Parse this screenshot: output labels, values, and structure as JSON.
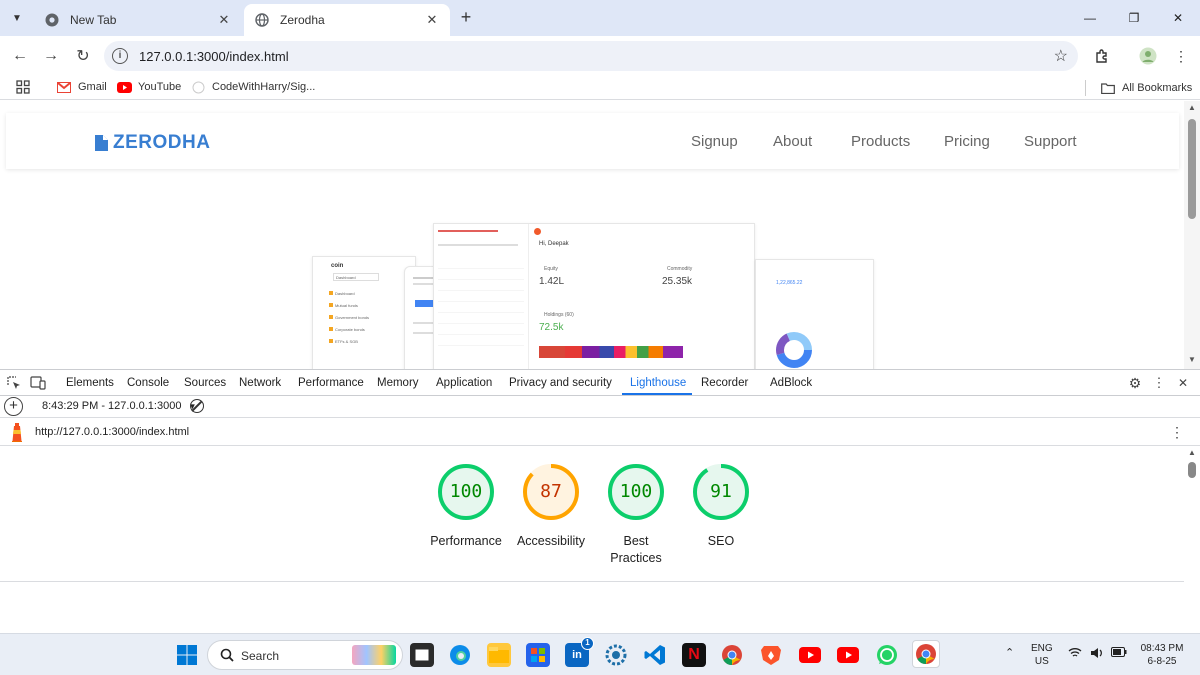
{
  "browser": {
    "tabs": [
      {
        "title": "New Tab",
        "active": false
      },
      {
        "title": "Zerodha",
        "active": true
      }
    ],
    "url": "127.0.0.1:3000/index.html",
    "bookmarks": [
      {
        "label": "Gmail"
      },
      {
        "label": "YouTube"
      },
      {
        "label": "CodeWithHarry/Sig..."
      }
    ],
    "all_bookmarks_label": "All Bookmarks"
  },
  "site": {
    "logo_text": "ZERODHA",
    "nav": [
      "Signup",
      "About",
      "Products",
      "Pricing",
      "Support"
    ],
    "hero_mock": {
      "greeting": "Hi, Deepak",
      "equity_label": "Equity",
      "equity_value": "1.42L",
      "commodity_label": "Commodity",
      "commodity_value": "25.35k",
      "holdings_label": "Holdings (60)",
      "holdings_value": "72.5k",
      "coin_label": "coin",
      "coin_menu": [
        "Dashboard",
        "Mutual funds",
        "Government bonds",
        "Corporate bonds",
        "ETFs & SGB"
      ],
      "coin_dropdown": "Dashboard",
      "portfolio_value": "1,22,865.22"
    }
  },
  "devtools": {
    "tabs": [
      "Elements",
      "Console",
      "Sources",
      "Network",
      "Performance",
      "Memory",
      "Application",
      "Privacy and security",
      "Lighthouse",
      "Recorder",
      "AdBlock"
    ],
    "active_tab": "Lighthouse",
    "report_select": "8:43:29 PM - 127.0.0.1:3000",
    "report_url": "http://127.0.0.1:3000/index.html",
    "scores": [
      {
        "label": "Performance",
        "score": 100,
        "status": "pass"
      },
      {
        "label": "Accessibility",
        "score": 87,
        "status": "average"
      },
      {
        "label": "Best Practices",
        "score": 100,
        "status": "pass"
      },
      {
        "label": "SEO",
        "score": 91,
        "status": "pass"
      }
    ],
    "colors": {
      "pass_stroke": "#0cce6b",
      "pass_fill": "#e6f7ee",
      "pass_text": "#008800",
      "average_stroke": "#ffa400",
      "average_fill": "#fff3e0",
      "average_text": "#c33300"
    }
  },
  "taskbar": {
    "search_placeholder": "Search",
    "language": "ENG",
    "region": "US",
    "time": "08:43 PM",
    "date": "6-8-25",
    "linkedin_badge": "1"
  }
}
